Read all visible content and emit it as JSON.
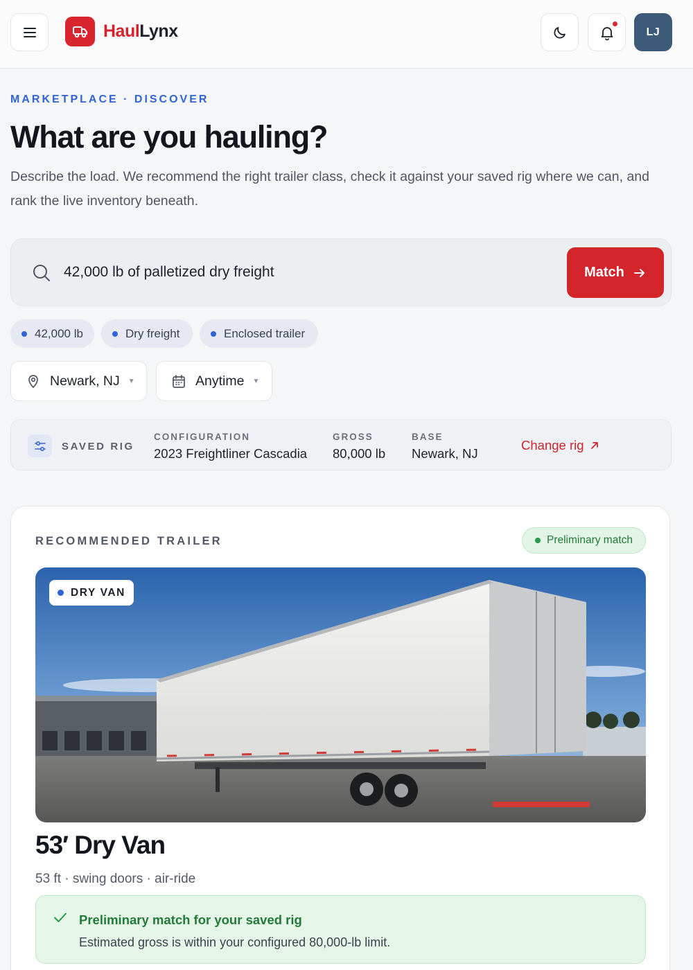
{
  "header": {
    "brand_part1": "Haul",
    "brand_part2": "Lynx",
    "avatar_initials": "LJ",
    "icons": [
      "menu-icon",
      "truck-icon",
      "moon-icon",
      "bell-icon"
    ],
    "accent": "#d3232b"
  },
  "intro": {
    "eyebrow": "MARKETPLACE · DISCOVER",
    "title": "What are you hauling?",
    "description": "Describe the load. We recommend the right trailer class, check it against your saved rig where we can, and rank the live inventory beneath."
  },
  "search": {
    "value": "42,000 lb of palletized dry freight",
    "button_label": "Match"
  },
  "chips": [
    "42,000 lb",
    "Dry freight",
    "Enclosed trailer"
  ],
  "filters": {
    "location": "Newark, NJ",
    "date": "Anytime"
  },
  "rig": {
    "label": "SAVED RIG",
    "config_key": "CONFIGURATION",
    "config_value": "2023 Freightliner Cascadia",
    "gross_key": "GROSS",
    "gross_value": "80,000 lb",
    "base_key": "BASE",
    "base_value": "Newark, NJ",
    "change_label": "Change rig"
  },
  "recommendation": {
    "section_label": "RECOMMENDED TRAILER",
    "badge": "Preliminary match",
    "type_tag": "DRY VAN",
    "name": "53′  Dry Van",
    "specs": "53 ft · swing doors · air-ride",
    "note_title": "Preliminary match for your saved rig",
    "note_detail": "Estimated gross is within your configured 80,000-lb limit."
  }
}
